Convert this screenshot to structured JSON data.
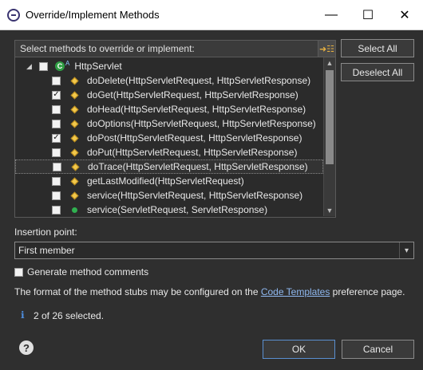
{
  "window": {
    "title": "Override/Implement Methods",
    "minimize_glyph": "—",
    "maximize_glyph": "☐",
    "close_glyph": "✕"
  },
  "methods_panel": {
    "header_label": "Select methods to override or implement:",
    "sort_icon": "sort-by-type-icon",
    "class_name": "HttpServlet",
    "items": [
      {
        "label": "doDelete(HttpServletRequest, HttpServletResponse)",
        "checked": false,
        "icon": "protected-method-icon"
      },
      {
        "label": "doGet(HttpServletRequest, HttpServletResponse)",
        "checked": true,
        "icon": "protected-method-icon"
      },
      {
        "label": "doHead(HttpServletRequest, HttpServletResponse)",
        "checked": false,
        "icon": "protected-method-icon"
      },
      {
        "label": "doOptions(HttpServletRequest, HttpServletResponse)",
        "checked": false,
        "icon": "protected-method-icon"
      },
      {
        "label": "doPost(HttpServletRequest, HttpServletResponse)",
        "checked": true,
        "icon": "protected-method-icon"
      },
      {
        "label": "doPut(HttpServletRequest, HttpServletResponse)",
        "checked": false,
        "icon": "protected-method-icon"
      },
      {
        "label": "doTrace(HttpServletRequest, HttpServletResponse)",
        "checked": false,
        "icon": "protected-method-icon"
      },
      {
        "label": "getLastModified(HttpServletRequest)",
        "checked": false,
        "icon": "protected-method-icon"
      },
      {
        "label": "service(HttpServletRequest, HttpServletResponse)",
        "checked": false,
        "icon": "protected-method-icon"
      },
      {
        "label": "service(ServletRequest, ServletResponse)",
        "checked": false,
        "icon": "public-method-icon"
      }
    ]
  },
  "buttons": {
    "select_all": "Select All",
    "deselect_all": "Deselect All",
    "ok": "OK",
    "cancel": "Cancel"
  },
  "insertion": {
    "label": "Insertion point:",
    "value": "First member"
  },
  "generate_comments": {
    "label": "Generate method comments",
    "checked": false
  },
  "info_text": {
    "prefix": "The format of the method stubs may be configured on the ",
    "link": "Code Templates",
    "suffix": " preference page."
  },
  "status": {
    "text": "2 of 26 selected."
  },
  "colors": {
    "background": "#2f2f2f",
    "titlebar": "#ffffff",
    "link": "#8fb8f0",
    "class_icon": "#2f9e44",
    "method_icon": "#f2c84b"
  }
}
